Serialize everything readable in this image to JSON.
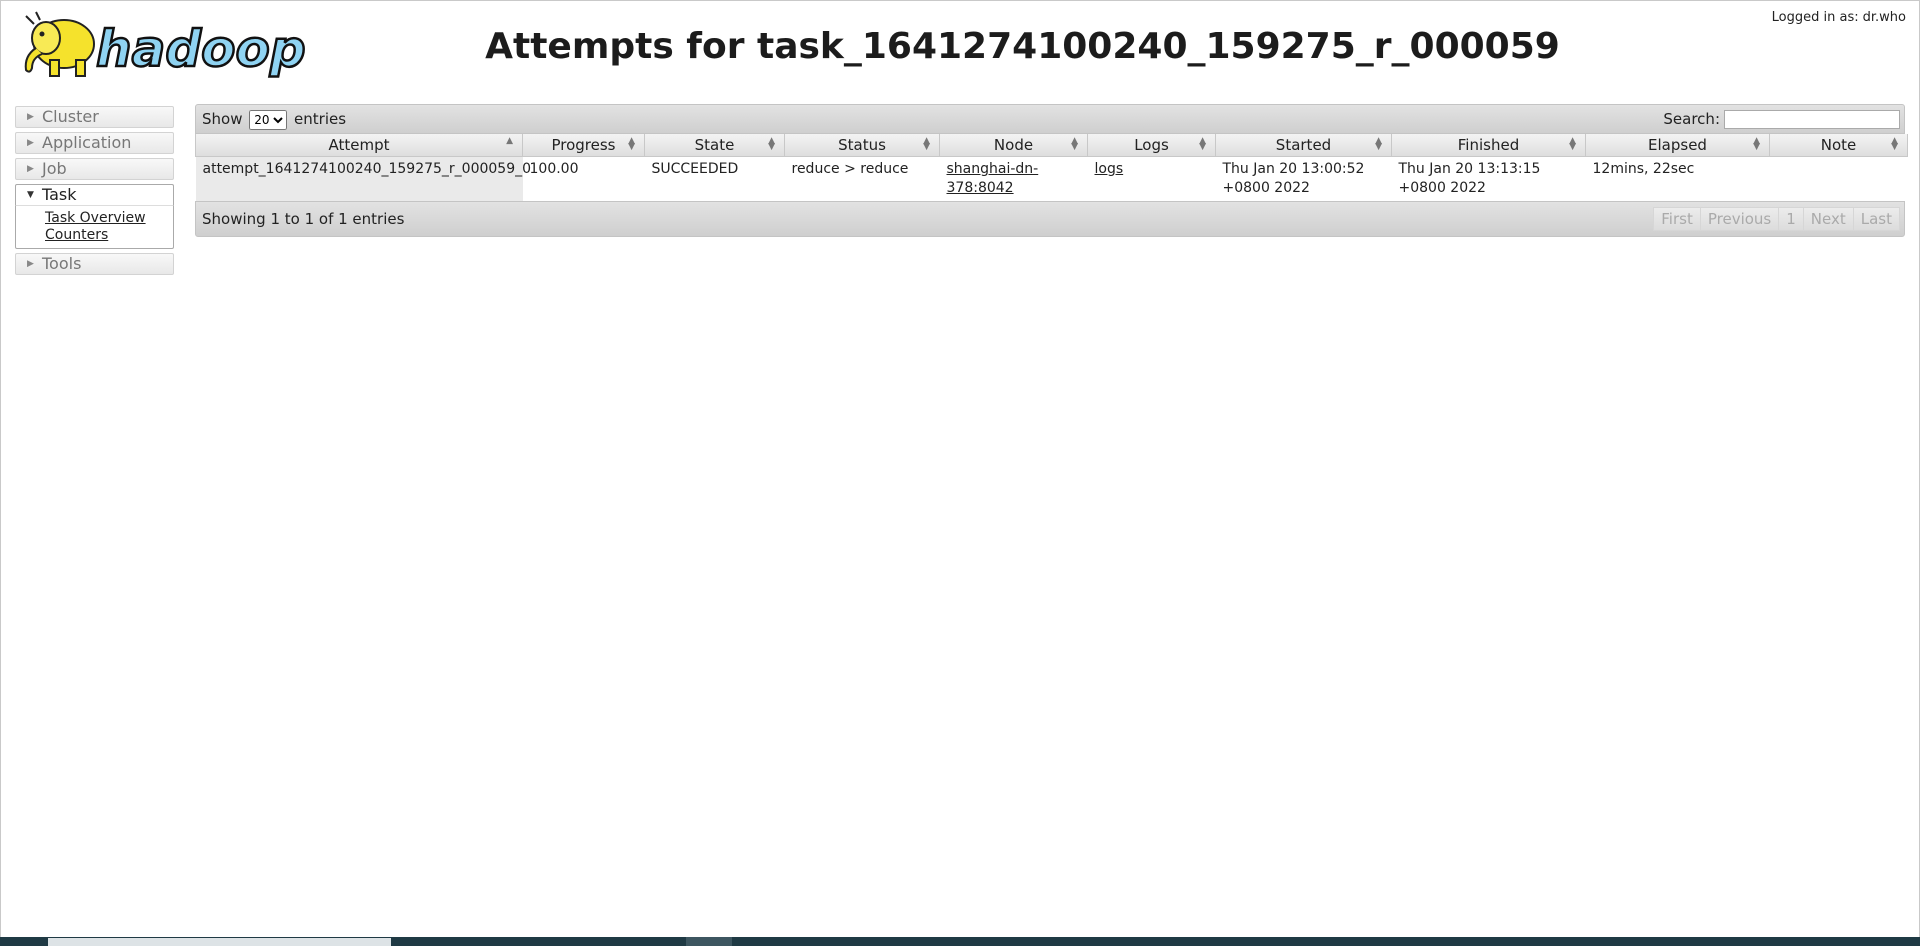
{
  "header": {
    "logo_text": "hadoop",
    "title": "Attempts for task_1641274100240_159275_r_000059",
    "logged_in_label": "Logged in as:",
    "logged_in_user": "dr.who"
  },
  "sidebar": {
    "items": [
      {
        "label": "Cluster",
        "icon": "triangle-right-icon",
        "open": false
      },
      {
        "label": "Application",
        "icon": "triangle-right-icon",
        "open": false
      },
      {
        "label": "Job",
        "icon": "triangle-right-icon",
        "open": false
      },
      {
        "label": "Task",
        "icon": "triangle-down-icon",
        "open": true,
        "links": [
          "Task Overview",
          "Counters"
        ]
      },
      {
        "label": "Tools",
        "icon": "triangle-right-icon",
        "open": false
      }
    ]
  },
  "table": {
    "show_label": "Show",
    "entries_label": "entries",
    "page_size": "20",
    "page_size_options": [
      "20"
    ],
    "search_label": "Search:",
    "search_value": "",
    "columns": [
      "Attempt",
      "Progress",
      "State",
      "Status",
      "Node",
      "Logs",
      "Started",
      "Finished",
      "Elapsed",
      "Note"
    ],
    "rows": [
      {
        "attempt": "attempt_1641274100240_159275_r_000059_0",
        "progress": "100.00",
        "state": "SUCCEEDED",
        "status": "reduce > reduce",
        "node_line1": "shanghai-dn-",
        "node_line2": "378:8042",
        "logs": "logs",
        "started_line1": "Thu Jan 20 13:00:52",
        "started_line2": "+0800 2022",
        "finished_line1": "Thu Jan 20 13:13:15",
        "finished_line2": "+0800 2022",
        "elapsed": "12mins, 22sec",
        "note": ""
      }
    ],
    "info": "Showing 1 to 1 of 1 entries",
    "pager": {
      "first": "First",
      "previous": "Previous",
      "page": "1",
      "next": "Next",
      "last": "Last"
    }
  },
  "colors": {
    "header_gradient_top": "#e2e2e2",
    "header_gradient_bottom": "#cfcfcf",
    "taskbar": "#1f3a44"
  }
}
